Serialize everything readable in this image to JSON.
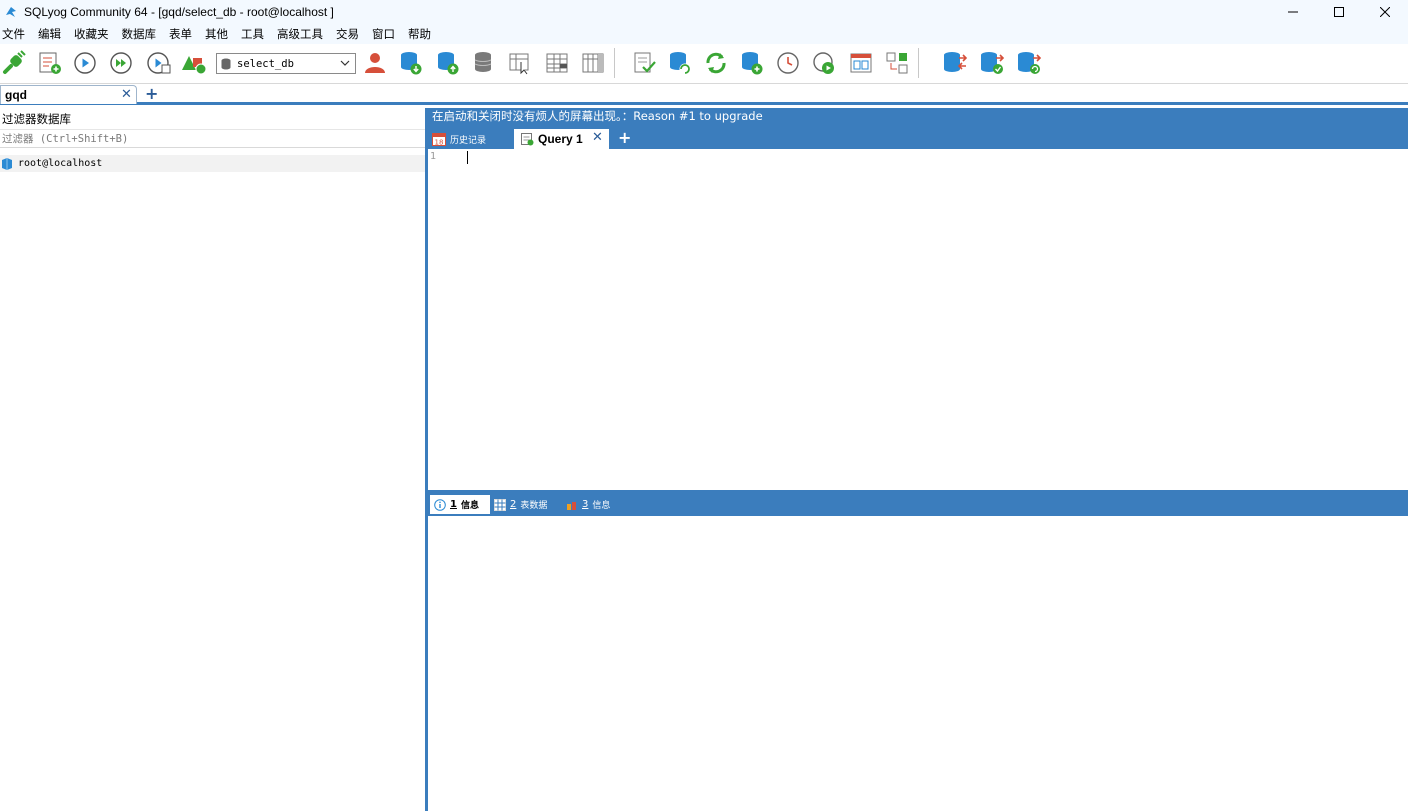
{
  "window": {
    "title": "SQLyog Community 64 - [gqd/select_db - root@localhost ]",
    "controls": [
      "minimize",
      "maximize",
      "close"
    ]
  },
  "menu": {
    "items": [
      "文件",
      "编辑",
      "收藏夹",
      "数据库",
      "表单",
      "其他",
      "工具",
      "高级工具",
      "交易",
      "窗口",
      "帮助"
    ]
  },
  "toolbar": {
    "database_selected": "select_db"
  },
  "connection_tabs": {
    "active_label": "gqd",
    "close_glyph": "✕",
    "add_glyph": "+"
  },
  "left_panel": {
    "title": "过滤器数据库",
    "filter_placeholder": "过滤器 (Ctrl+Shift+B)",
    "tree": [
      {
        "label": "root@localhost"
      }
    ]
  },
  "right_panel": {
    "upgrade_banner": "在启动和关闭时没有烦人的屏幕出现。：Reason #1 to upgrade",
    "query_tabs": {
      "history_label": "历史记录",
      "history_badge": "18",
      "active_label": "Query 1",
      "close_glyph": "✕",
      "add_glyph": "+"
    },
    "editor": {
      "line_numbers": [
        "1"
      ]
    },
    "result_tabs": [
      {
        "num": "1",
        "label": "信息"
      },
      {
        "num": "2",
        "label": "表数据"
      },
      {
        "num": "3",
        "label": "信息"
      }
    ]
  },
  "colors": {
    "accent_blue": "#3b7dbd",
    "titlebar_bg": "#f3f9ff",
    "icon_green": "#3aa635",
    "icon_blue": "#2a8ad4",
    "icon_red": "#d64f3a"
  }
}
